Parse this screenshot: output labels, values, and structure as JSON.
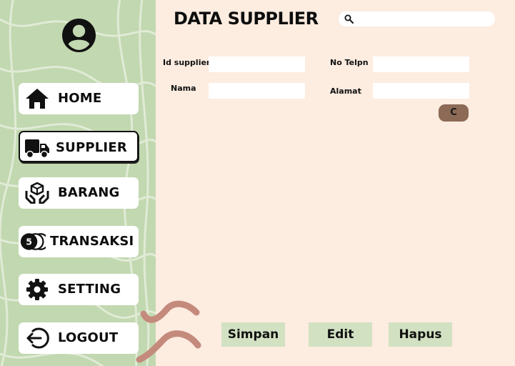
{
  "page": {
    "title": "DATA SUPPLIER"
  },
  "search": {
    "value": "",
    "placeholder": "",
    "icon": "search-icon"
  },
  "sidebar": {
    "avatar_icon": "account-circle-icon",
    "items": [
      {
        "label": "HOME",
        "icon": "home-icon",
        "active": false
      },
      {
        "label": "SUPPLIER",
        "icon": "truck-icon",
        "active": true
      },
      {
        "label": "BARANG",
        "icon": "box-in-hands-icon",
        "active": false
      },
      {
        "label": "TRANSAKSI",
        "icon": "coins-icon",
        "active": false
      },
      {
        "label": "SETTING",
        "icon": "gear-icon",
        "active": false
      },
      {
        "label": "LOGOUT",
        "icon": "logout-icon",
        "active": false
      }
    ]
  },
  "form": {
    "id_supplier": {
      "label": "Id supplier",
      "value": ""
    },
    "nama": {
      "label": "Nama",
      "value": ""
    },
    "no_telpn": {
      "label": "No Telpn",
      "value": ""
    },
    "alamat": {
      "label": "Alamat",
      "value": ""
    },
    "clear_label": "C"
  },
  "actions": {
    "save_label": "Simpan",
    "edit_label": "Edit",
    "delete_label": "Hapus"
  },
  "colors": {
    "sidebar_bg": "#c2d8b0",
    "main_bg": "#fdece0",
    "button_bg": "#d2e1c2",
    "clear_button_bg": "#8c6a55",
    "decor": "#c48a7c"
  }
}
